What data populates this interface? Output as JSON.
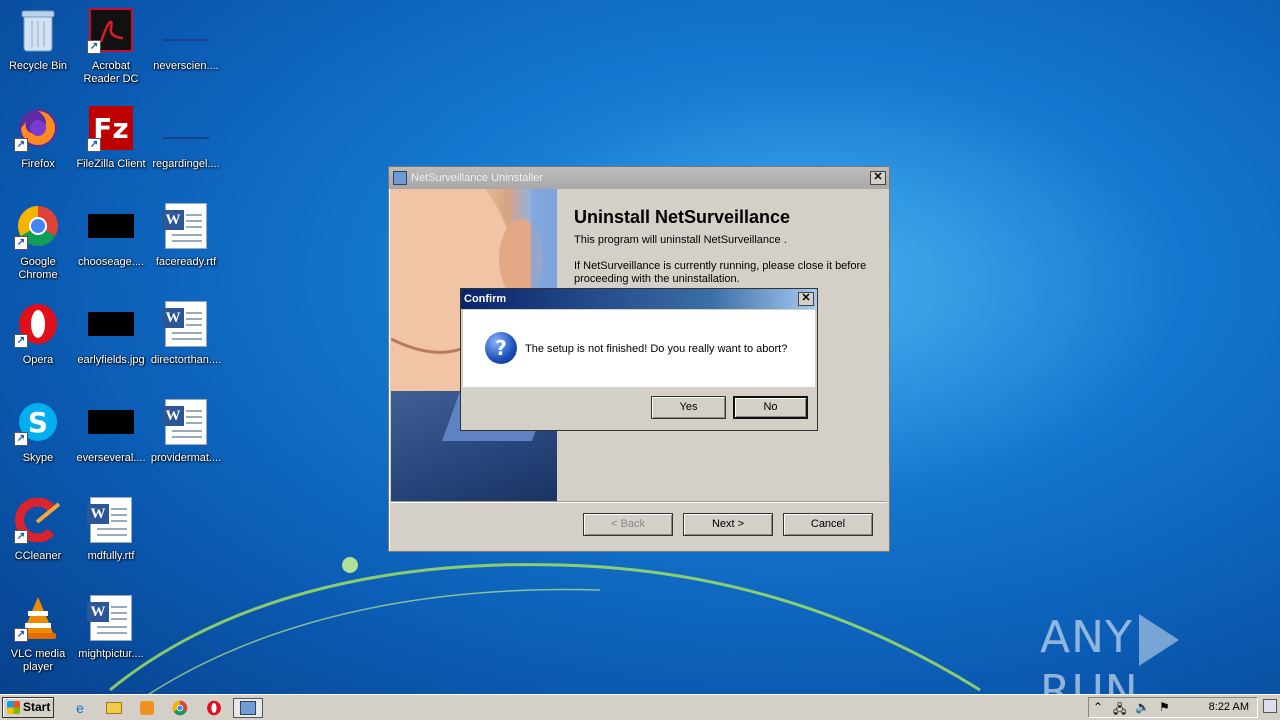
{
  "desktop": {
    "icons": [
      {
        "label": "Recycle Bin",
        "icon": "recycle-bin-icon"
      },
      {
        "label": "Acrobat Reader DC",
        "icon": "acrobat-icon"
      },
      {
        "label": "neverscien....",
        "icon": "file-icon"
      },
      {
        "label": "Firefox",
        "icon": "firefox-icon"
      },
      {
        "label": "FileZilla Client",
        "icon": "filezilla-icon"
      },
      {
        "label": "regardingel....",
        "icon": "file-icon"
      },
      {
        "label": "Google Chrome",
        "icon": "chrome-icon"
      },
      {
        "label": "chooseage....",
        "icon": "image-icon"
      },
      {
        "label": "faceready.rtf",
        "icon": "word-doc-icon"
      },
      {
        "label": "Opera",
        "icon": "opera-icon"
      },
      {
        "label": "earlyfields.jpg",
        "icon": "image-icon"
      },
      {
        "label": "directorthan....",
        "icon": "word-doc-icon"
      },
      {
        "label": "Skype",
        "icon": "skype-icon"
      },
      {
        "label": "everseveral....",
        "icon": "image-icon"
      },
      {
        "label": "providermat....",
        "icon": "word-doc-icon"
      },
      {
        "label": "CCleaner",
        "icon": "ccleaner-icon"
      },
      {
        "label": "mdfully.rtf",
        "icon": "word-doc-icon"
      },
      {
        "label": "VLC media player",
        "icon": "vlc-icon"
      },
      {
        "label": "mightpictur....",
        "icon": "word-doc-icon"
      }
    ]
  },
  "installer": {
    "title": "NetSurveillance Uninstaller",
    "close": "✕",
    "heading": "Uninstall NetSurveillance",
    "line1": "This program will uninstall NetSurveillance .",
    "line2": "If NetSurveillance is currently running, please close it before proceeding with the uninstallation.",
    "back_label": "< Back",
    "next_label": "Next >",
    "cancel_label": "Cancel"
  },
  "confirm": {
    "title": "Confirm",
    "close": "✕",
    "icon_glyph": "?",
    "message": "The setup is not finished! Do you really want to abort?",
    "yes_label": "Yes",
    "no_label": "No"
  },
  "taskbar": {
    "start_label": "Start",
    "clock": "8:22 AM",
    "pinned": [
      "ie-icon",
      "explorer-icon",
      "media-player-icon",
      "chrome-icon",
      "opera-icon",
      "uninstaller-icon"
    ]
  },
  "watermark": {
    "text_left": "ANY",
    "text_right": "RUN"
  }
}
